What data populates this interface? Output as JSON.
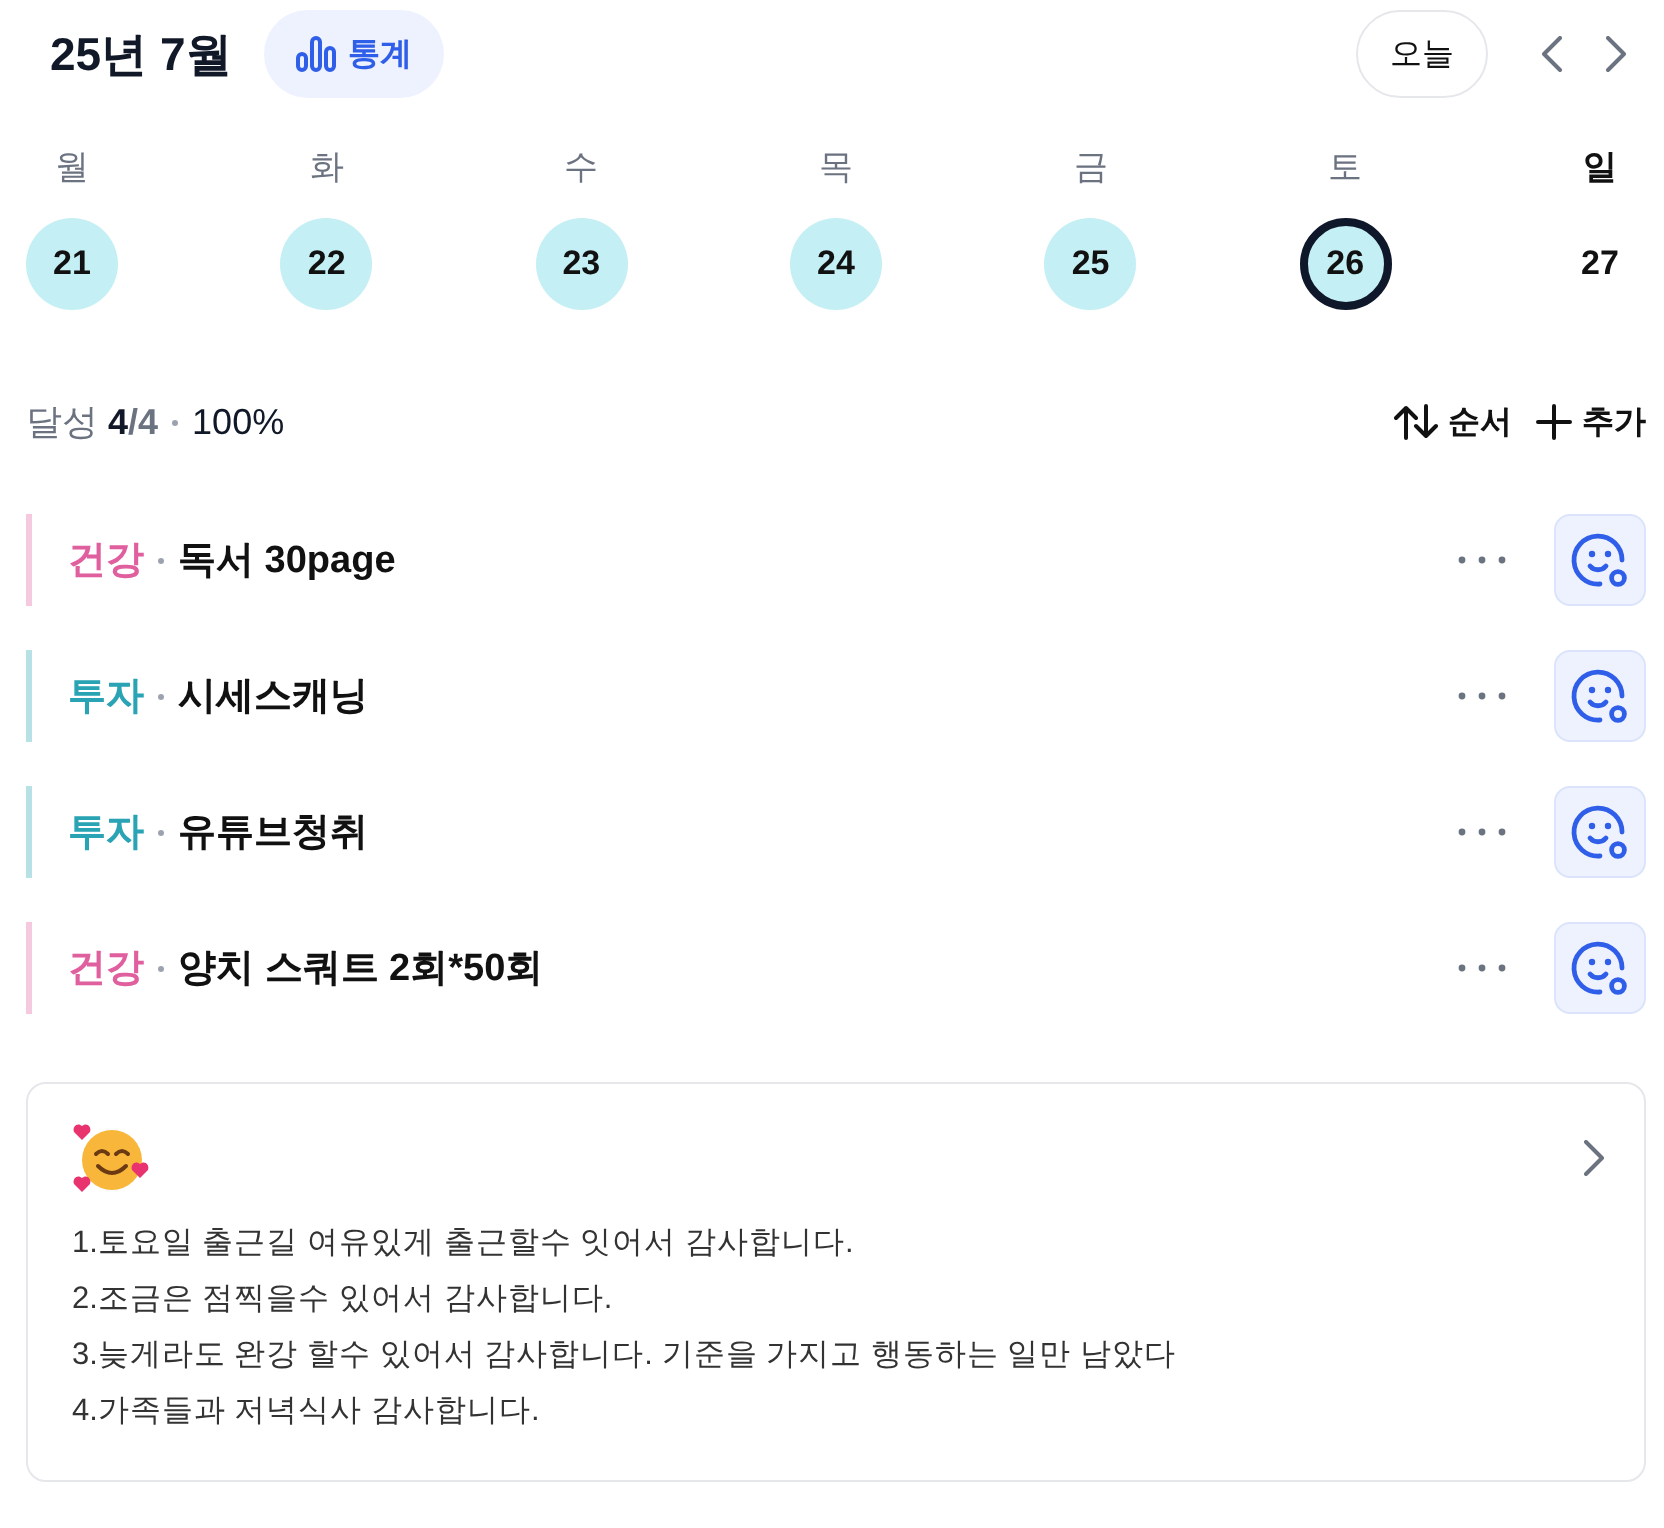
{
  "header": {
    "title": "25년 7월",
    "stats_button": "통계",
    "today_button": "오늘"
  },
  "days": [
    {
      "weekday": "월",
      "date": "21",
      "done": true,
      "selected": false,
      "emphasized": false
    },
    {
      "weekday": "화",
      "date": "22",
      "done": true,
      "selected": false,
      "emphasized": false
    },
    {
      "weekday": "수",
      "date": "23",
      "done": true,
      "selected": false,
      "emphasized": false
    },
    {
      "weekday": "목",
      "date": "24",
      "done": true,
      "selected": false,
      "emphasized": false
    },
    {
      "weekday": "금",
      "date": "25",
      "done": true,
      "selected": false,
      "emphasized": false
    },
    {
      "weekday": "토",
      "date": "26",
      "done": true,
      "selected": true,
      "emphasized": false
    },
    {
      "weekday": "일",
      "date": "27",
      "done": false,
      "selected": false,
      "emphasized": true
    }
  ],
  "summary": {
    "label": "달성",
    "done": "4",
    "total": "/4",
    "percent": "100%",
    "sort_button": "순서",
    "add_button": "추가"
  },
  "habits": [
    {
      "category": "건강",
      "color": "#e0609f",
      "title": "독서 30page"
    },
    {
      "category": "투자",
      "color": "#2aa4b4",
      "title": "시세스캐닝"
    },
    {
      "category": "투자",
      "color": "#2aa4b4",
      "title": "유튜브청취"
    },
    {
      "category": "건강",
      "color": "#e0609f",
      "title": "양치 스쿼트 2회*50회"
    }
  ],
  "journal": {
    "lines": [
      "1.토요일 출근길 여유있게 출근할수 잇어서 감사합니다.",
      "2.조금은 점찍을수 있어서 감사합니다.",
      "3.늦게라도 완강 할수 있어서 감사합니다. 기준을 가지고 행동하는 일만 남았다",
      "4.가족들과 저녁식사 감사합니다."
    ]
  }
}
